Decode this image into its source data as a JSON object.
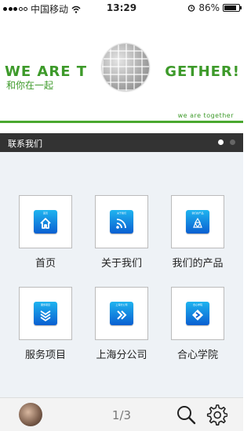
{
  "status": {
    "carrier": "中国移动",
    "time": "13:29",
    "battery": "86%",
    "battery_level": 0.86
  },
  "banner": {
    "title_left": "WE ARE T",
    "title_right": "GETHER!",
    "subtitle": "和你在一起",
    "tagline": "we are together"
  },
  "section": {
    "title": "联系我们",
    "page_dots": 2,
    "active_dot": 0
  },
  "tiles": [
    {
      "label": "首页",
      "icon_caption": "首页",
      "icon": "home-icon"
    },
    {
      "label": "关于我们",
      "icon_caption": "关于我们",
      "icon": "rss-icon"
    },
    {
      "label": "我们的产品",
      "icon_caption": "我们的产品",
      "icon": "recycle-icon"
    },
    {
      "label": "服务项目",
      "icon_caption": "服务项目",
      "icon": "layers-icon"
    },
    {
      "label": "上海分公司",
      "icon_caption": "上海分公司",
      "icon": "double-chevron-icon"
    },
    {
      "label": "合心学院",
      "icon_caption": "合心学院",
      "icon": "diamond-arrow-icon"
    }
  ],
  "bottom": {
    "page_indicator": "1/3"
  },
  "colors": {
    "brand_green": "#3d9a2a",
    "section_bar": "#333333",
    "icon_blue": "#0a5fd1"
  }
}
